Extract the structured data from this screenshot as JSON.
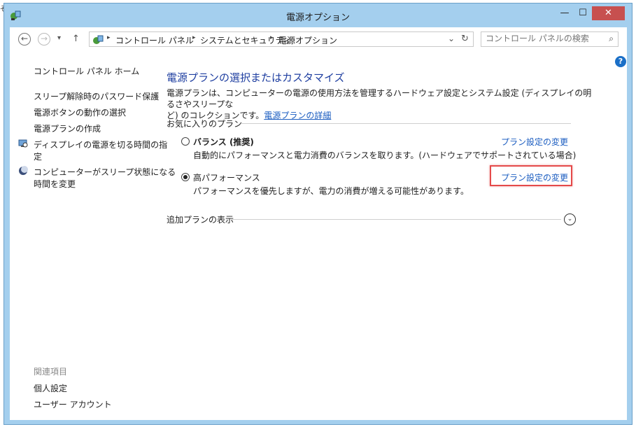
{
  "window": {
    "title": "電源オプション",
    "minimize": "—",
    "maximize": "☐",
    "close": "✕",
    "stray_glyph": "ぞ"
  },
  "nav": {
    "back": "←",
    "forward": "→",
    "recent": "▾",
    "up": "↑",
    "breadcrumb": [
      "コントロール パネル",
      "システムとセキュリティ",
      "電源オプション"
    ],
    "separator": "▸",
    "dropdown": "⌄",
    "refresh": "↻",
    "search_placeholder": "コントロール パネルの検索",
    "search_icon": "⌕"
  },
  "help_label": "?",
  "sidebar": {
    "home": "コントロール パネル ホーム",
    "links": [
      "スリープ解除時のパスワード保護",
      "電源ボタンの動作の選択",
      "電源プランの作成",
      "ディスプレイの電源を切る時間の指定",
      "コンピューターがスリープ状態になる時間を変更"
    ],
    "link4_lines": [
      "ディスプレイの電源を切る時間の指",
      "定"
    ],
    "link5_lines": [
      "コンピューターがスリープ状態になる",
      "時間を変更"
    ],
    "related_title": "関連項目",
    "related_links": [
      "個人設定",
      "ユーザー アカウント"
    ]
  },
  "main": {
    "heading": "電源プランの選択またはカスタマイズ",
    "description_line1": "電源プランは、コンピューターの電源の使用方法を管理するハードウェア設定とシステム設定 (ディスプレイの明るさやスリープな",
    "description_line2": "ど) のコレクションです。",
    "description_link": "電源プランの詳細",
    "favorites_label": "お気に入りのプラン",
    "plans": [
      {
        "name": "バランス (推奨)",
        "description": "自動的にパフォーマンスと電力消費のバランスを取ります。(ハードウェアでサポートされている場合)",
        "link": "プラン設定の変更",
        "selected": false
      },
      {
        "name": "高パフォーマンス",
        "description": "パフォーマンスを優先しますが、電力の消費が増える可能性があります。",
        "link": "プラン設定の変更",
        "selected": true
      }
    ],
    "more_plans_label": "追加プランの表示",
    "expand_icon": "⌄"
  },
  "colors": {
    "frame": "#a4cfee",
    "link": "#1a5cc0",
    "heading": "#1e3ea0",
    "close_button": "#c7504f",
    "highlight": "#e54a4a"
  },
  "icons": {
    "app": "power-options-icon",
    "display_timer": "monitor-clock-icon",
    "sleep": "moon-sleep-icon"
  }
}
